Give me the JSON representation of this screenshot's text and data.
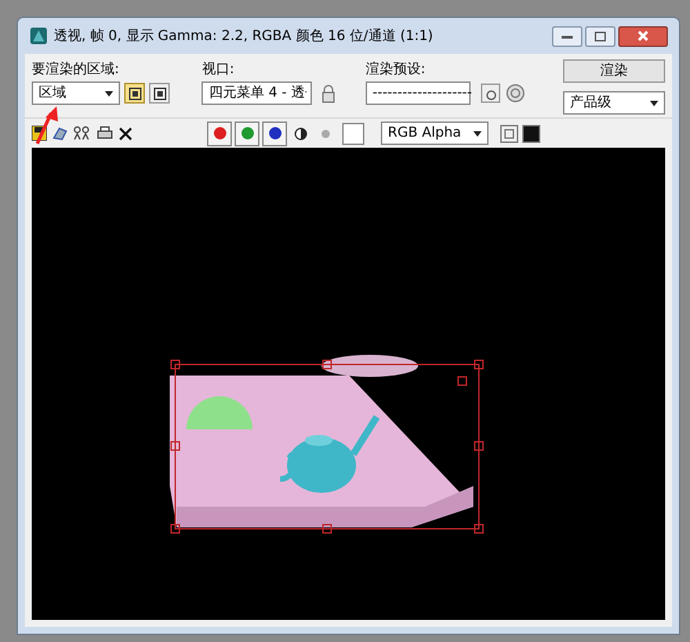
{
  "window": {
    "title": "透视, 帧 0, 显示 Gamma: 2.2, RGBA 颜色 16 位/通道 (1:1)"
  },
  "area": {
    "label": "要渲染的区域:",
    "value": "区域"
  },
  "viewport": {
    "label": "视口:",
    "value": "四元菜单 4 - 透"
  },
  "preset": {
    "label": "渲染预设:",
    "value": "--------------------"
  },
  "render_button": "渲染",
  "quality": {
    "value": "产品级"
  },
  "channels": [
    {
      "color": "#dd1f1f",
      "on": true
    },
    {
      "color": "#1f9a2f",
      "on": true
    },
    {
      "color": "#1f2fbf",
      "on": true
    }
  ],
  "channel_display": {
    "value": "RGB Alpha"
  }
}
